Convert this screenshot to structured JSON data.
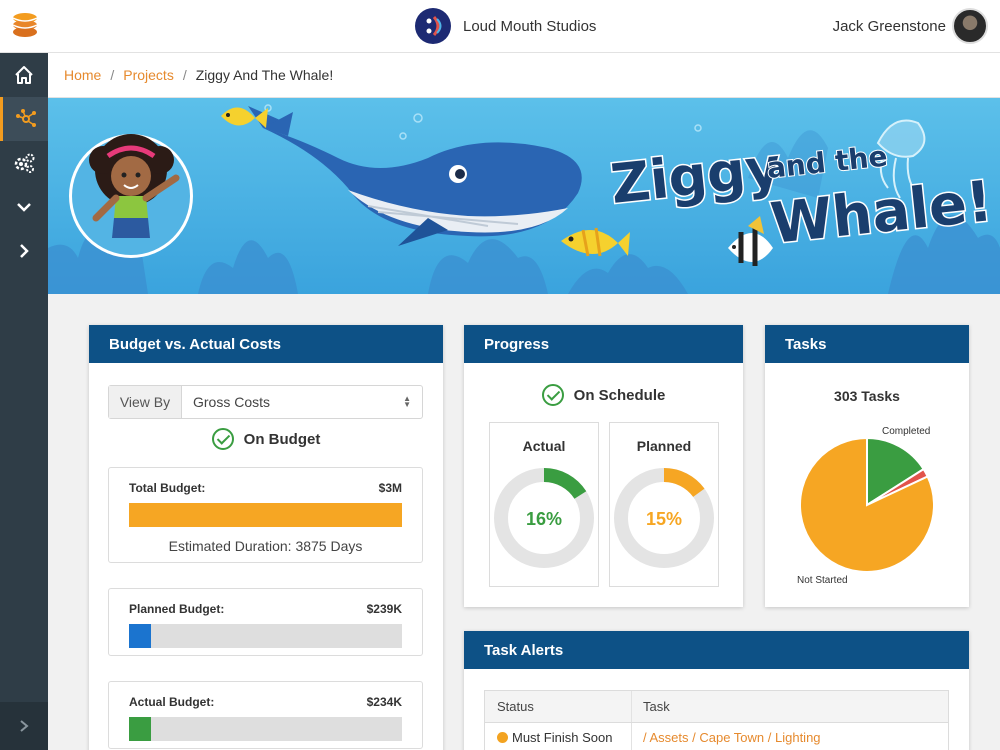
{
  "header": {
    "studio_name": "Loud Mouth Studios",
    "user_name": "Jack Greenstone"
  },
  "sidebar": {
    "items": [
      {
        "icon": "home-icon",
        "active": false
      },
      {
        "icon": "network-icon",
        "active": true
      },
      {
        "icon": "gears-icon",
        "active": false
      },
      {
        "icon": "chevron-down-icon",
        "active": false
      },
      {
        "icon": "chevron-right-icon",
        "active": false
      }
    ],
    "bottom_icon": "chevron-right-icon"
  },
  "breadcrumb": {
    "home": "Home",
    "projects": "Projects",
    "current": "Ziggy And The Whale!"
  },
  "banner": {
    "title_small": "and the",
    "title_line1": "Ziggy",
    "title_line2": "Whale!"
  },
  "budget_card": {
    "title": "Budget vs. Actual Costs",
    "view_by_label": "View By",
    "view_by_value": "Gross Costs",
    "status": "On Budget",
    "total": {
      "label": "Total Budget:",
      "value": "$3M",
      "fill": 1.0,
      "color": "#f6a623",
      "note": "Estimated Duration: 3875 Days"
    },
    "planned": {
      "label": "Planned Budget:",
      "value": "$239K",
      "fill": 0.08,
      "color": "#1b74cf"
    },
    "actual": {
      "label": "Actual Budget:",
      "value": "$234K",
      "fill": 0.08,
      "color": "#3a9d41"
    }
  },
  "progress_card": {
    "title": "Progress",
    "status": "On Schedule",
    "actual": {
      "label": "Actual",
      "text": "16%",
      "value": 16,
      "color": "#3a9d41"
    },
    "planned": {
      "label": "Planned",
      "text": "15%",
      "value": 15,
      "color": "#f6a623"
    }
  },
  "tasks_card": {
    "title": "Tasks",
    "total": "303 Tasks",
    "label_completed": "Completed",
    "label_not_started": "Not Started",
    "chart_data": {
      "type": "pie",
      "slices": [
        {
          "label": "Completed",
          "value": 16,
          "color": "#3a9d41"
        },
        {
          "label": "",
          "value": 2,
          "color": "#e2534b"
        },
        {
          "label": "Not Started",
          "value": 82,
          "color": "#f6a623"
        }
      ]
    }
  },
  "alerts_card": {
    "title": "Task Alerts",
    "col_status": "Status",
    "col_task": "Task",
    "rows": [
      {
        "status": "Must Finish Soon",
        "task": "/ Assets / Cape Town / Lighting",
        "color": "#f3a321"
      }
    ]
  },
  "colors": {
    "brand_blue": "#0d5186",
    "accent_orange": "#e68a2e",
    "sidebar": "#2f3d47"
  }
}
